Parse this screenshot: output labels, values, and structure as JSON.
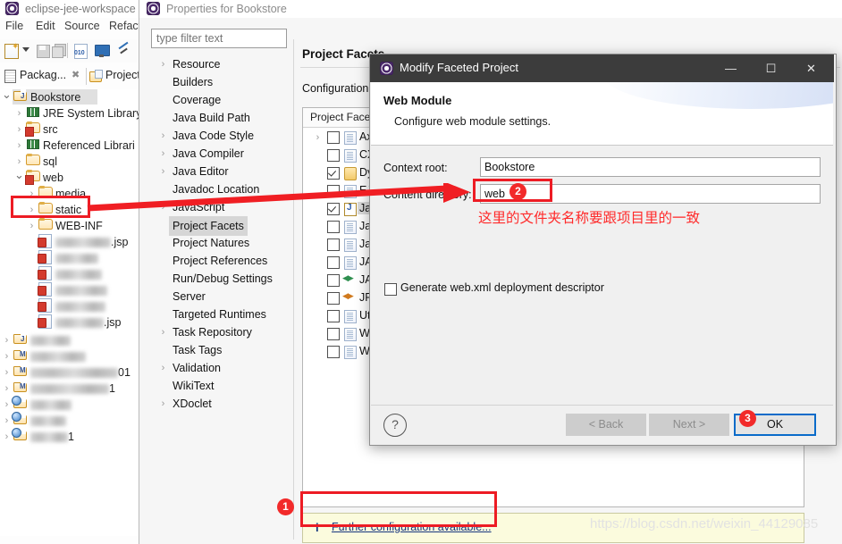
{
  "eclipse": {
    "window_title": "eclipse-jee-workspace -",
    "app_icon": "eclipse-icon",
    "menus": [
      "File",
      "Edit",
      "Source",
      "Refact"
    ],
    "toolbar_icons": [
      "new-wizard-icon",
      "dropdown-arrow-icon",
      "save-icon",
      "save-all-icon",
      "new-file-010-icon",
      "console-icon",
      "skip-breakpoints-icon"
    ],
    "view_tabs": [
      {
        "label": "Packag...",
        "icon": "package-explorer-icon",
        "close": "✖",
        "active": true
      },
      {
        "label": "Project",
        "icon": "project-explorer-icon",
        "active": false
      }
    ],
    "tree": [
      {
        "label": "Bookstore",
        "depth": 0,
        "twisty": "open",
        "icon": "java-project-icon",
        "selected": true,
        "blurred": false
      },
      {
        "label": "JRE System Library",
        "depth": 1,
        "twisty": "closed",
        "icon": "library-icon",
        "blurred": false
      },
      {
        "label": "src",
        "depth": 1,
        "twisty": "closed",
        "icon": "source-folder-icon",
        "blurred": false
      },
      {
        "label": "Referenced Librari",
        "depth": 1,
        "twisty": "closed",
        "icon": "library-icon",
        "blurred": false
      },
      {
        "label": "sql",
        "depth": 1,
        "twisty": "closed",
        "icon": "folder-icon",
        "blurred": false
      },
      {
        "label": "web",
        "depth": 1,
        "twisty": "open",
        "icon": "web-folder-icon",
        "blurred": false
      },
      {
        "label": "media",
        "depth": 2,
        "twisty": "closed",
        "icon": "folder-icon",
        "blurred": false
      },
      {
        "label": "static",
        "depth": 2,
        "twisty": "closed",
        "icon": "folder-icon",
        "blurred": false
      },
      {
        "label": "WEB-INF",
        "depth": 2,
        "twisty": "closed",
        "icon": "folder-icon",
        "blurred": false
      },
      {
        "label": ".jsp",
        "depth": 2,
        "twisty": "none",
        "icon": "jsp-file-icon",
        "blurred": true,
        "blur_width": 62
      },
      {
        "label": "",
        "depth": 2,
        "twisty": "none",
        "icon": "jsp-file-icon",
        "blurred": true,
        "blur_width": 48
      },
      {
        "label": "",
        "depth": 2,
        "twisty": "none",
        "icon": "jsp-file-icon",
        "blurred": true,
        "blur_width": 52
      },
      {
        "label": "",
        "depth": 2,
        "twisty": "none",
        "icon": "jsp-file-icon",
        "blurred": true,
        "blur_width": 58
      },
      {
        "label": "",
        "depth": 2,
        "twisty": "none",
        "icon": "jsp-file-icon",
        "blurred": true,
        "blur_width": 56
      },
      {
        "label": ".jsp",
        "depth": 2,
        "twisty": "none",
        "icon": "jsp-file-icon",
        "blurred": true,
        "blur_width": 54
      },
      {
        "label": "",
        "depth": 0,
        "twisty": "closed",
        "icon": "java-project-icon",
        "blurred": true,
        "blur_width": 45
      },
      {
        "label": "",
        "depth": 0,
        "twisty": "closed",
        "icon": "maven-project-icon",
        "blurred": true,
        "blur_width": 62
      },
      {
        "label": "01",
        "depth": 0,
        "twisty": "closed",
        "icon": "maven-project-icon",
        "blurred": true,
        "blur_width": 98
      },
      {
        "label": "1",
        "depth": 0,
        "twisty": "closed",
        "icon": "maven-project-icon",
        "blurred": true,
        "blur_width": 88
      },
      {
        "label": "",
        "depth": 0,
        "twisty": "closed",
        "icon": "web-project-icon",
        "blurred": true,
        "blur_width": 46
      },
      {
        "label": "",
        "depth": 0,
        "twisty": "closed",
        "icon": "web-project-icon",
        "blurred": true,
        "blur_width": 40
      },
      {
        "label": "1",
        "depth": 0,
        "twisty": "closed",
        "icon": "web-project-icon",
        "blurred": true,
        "blur_width": 42
      }
    ]
  },
  "properties_dialog": {
    "title": "Properties for Bookstore",
    "app_icon": "eclipse-icon",
    "filter_placeholder": "type filter text",
    "nav_items": [
      {
        "label": "Resource",
        "twisty": "closed"
      },
      {
        "label": "Builders",
        "twisty": "none"
      },
      {
        "label": "Coverage",
        "twisty": "none"
      },
      {
        "label": "Java Build Path",
        "twisty": "none"
      },
      {
        "label": "Java Code Style",
        "twisty": "closed"
      },
      {
        "label": "Java Compiler",
        "twisty": "closed"
      },
      {
        "label": "Java Editor",
        "twisty": "closed"
      },
      {
        "label": "Javadoc Location",
        "twisty": "none"
      },
      {
        "label": "JavaScript",
        "twisty": "closed"
      },
      {
        "label": "Project Facets",
        "twisty": "none",
        "selected": true
      },
      {
        "label": "Project Natures",
        "twisty": "none"
      },
      {
        "label": "Project References",
        "twisty": "none"
      },
      {
        "label": "Run/Debug Settings",
        "twisty": "none"
      },
      {
        "label": "Server",
        "twisty": "none"
      },
      {
        "label": "Targeted Runtimes",
        "twisty": "none"
      },
      {
        "label": "Task Repository",
        "twisty": "closed"
      },
      {
        "label": "Task Tags",
        "twisty": "none"
      },
      {
        "label": "Validation",
        "twisty": "closed"
      },
      {
        "label": "WikiText",
        "twisty": "none"
      },
      {
        "label": "XDoclet",
        "twisty": "closed"
      }
    ],
    "page_title": "Project Facets",
    "configuration_label": "Configuration",
    "facets_column_header": "Project Facet",
    "facets": [
      {
        "label": "Axi",
        "checked": false,
        "twisty": "closed",
        "icon": "facet-doc-icon"
      },
      {
        "label": "CX",
        "checked": false,
        "twisty": "none",
        "icon": "facet-doc-icon"
      },
      {
        "label": "Dy",
        "checked": true,
        "twisty": "none",
        "icon": "facet-jar-icon"
      },
      {
        "label": "EJB",
        "checked": false,
        "twisty": "none",
        "icon": "facet-doc-icon"
      },
      {
        "label": "Jav",
        "checked": true,
        "twisty": "none",
        "icon": "facet-java-icon",
        "selected": true
      },
      {
        "label": "Jav",
        "checked": false,
        "twisty": "none",
        "icon": "facet-doc-icon"
      },
      {
        "label": "Jav",
        "checked": false,
        "twisty": "none",
        "icon": "facet-doc-icon"
      },
      {
        "label": "JAX",
        "checked": false,
        "twisty": "none",
        "icon": "facet-doc-icon"
      },
      {
        "label": "JAX",
        "checked": false,
        "twisty": "none",
        "icon": "facet-arrow-green-icon"
      },
      {
        "label": "JPA",
        "checked": false,
        "twisty": "none",
        "icon": "facet-arrow-orange-icon"
      },
      {
        "label": "Uti",
        "checked": false,
        "twisty": "none",
        "icon": "facet-doc-icon"
      },
      {
        "label": "We",
        "checked": false,
        "twisty": "none",
        "icon": "facet-doc-icon"
      },
      {
        "label": "We",
        "checked": false,
        "twisty": "none",
        "icon": "facet-doc-icon"
      }
    ],
    "info_bar": {
      "icon": "info-icon",
      "link_text": "Further configuration available..."
    },
    "scroll_chevron": "chevron-down-icon"
  },
  "facet_dialog": {
    "title": "Modify Faceted Project",
    "title_icon": "eclipse-icon",
    "window_buttons": {
      "minimize": "—",
      "maximize": "☐",
      "close": "✕"
    },
    "heading": "Web Module",
    "subheading": "Configure web module settings.",
    "context_root_label": "Context root:",
    "context_root_value": "Bookstore",
    "content_directory_label": "Content directory:",
    "content_directory_value": "web",
    "generate_webxml_label": "Generate web.xml deployment descriptor",
    "generate_webxml_checked": false,
    "help_icon": "help-question-icon",
    "buttons": {
      "back": "< Back",
      "next": "Next >",
      "ok": "OK"
    }
  },
  "annotations": {
    "badge_1": "1",
    "badge_2": "2",
    "badge_3": "3",
    "chinese_note": "这里的文件夹名称要跟项目里的一致",
    "accent_color": "#ed1c24",
    "arrow": "red-arrow-pointing-to-content-directory"
  },
  "watermark": "https://blog.csdn.net/weixin_44129085"
}
